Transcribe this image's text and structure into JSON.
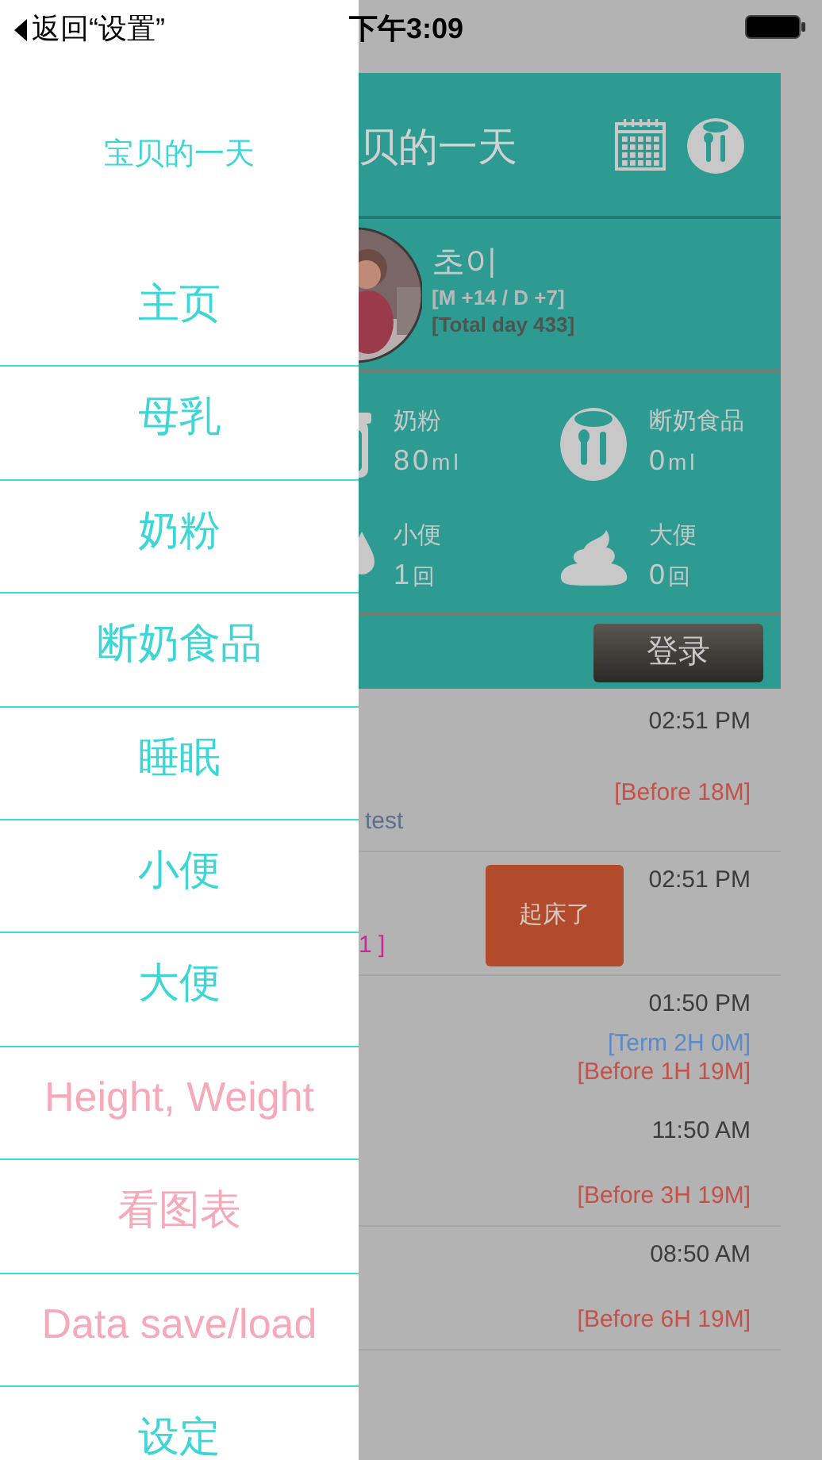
{
  "status_bar": {
    "back_label": "返回“设置”",
    "time": "下午3:09"
  },
  "drawer": {
    "title": "宝贝的一天",
    "items": [
      {
        "label": "主页",
        "color": "#3dd6d6"
      },
      {
        "label": "母乳",
        "color": "#3dd6d6"
      },
      {
        "label": "奶粉",
        "color": "#3dd6d6"
      },
      {
        "label": "断奶食品",
        "color": "#3dd6d6"
      },
      {
        "label": "睡眠",
        "color": "#3dd6d6"
      },
      {
        "label": "小便",
        "color": "#3dd6d6"
      },
      {
        "label": "大便",
        "color": "#3dd6d6"
      },
      {
        "label": "Height, Weight",
        "color": "#f6a9b8"
      },
      {
        "label": "看图表",
        "color": "#f6a9b8"
      },
      {
        "label": "Data save/load",
        "color": "#f6a9b8"
      },
      {
        "label": "设定",
        "color": "#3dd6d6"
      }
    ]
  },
  "header": {
    "title": "贝的一天"
  },
  "profile": {
    "name": "초이",
    "age": "[M +14 / D +7]",
    "total": "[Total day 433]"
  },
  "stats": [
    {
      "kind": "bottle",
      "label": "奶粉",
      "value": "80",
      "unit": "ml"
    },
    {
      "kind": "bib",
      "label": "断奶食品",
      "value": "0",
      "unit": "ml"
    },
    {
      "kind": "drop",
      "label": "小便",
      "value": "1",
      "unit": "回"
    },
    {
      "kind": "poop",
      "label": "大便",
      "value": "0",
      "unit": "回"
    }
  ],
  "login_button": "登录",
  "log": [
    {
      "time": "02:51 PM",
      "tags": [
        {
          "kind": "before",
          "text": "[Before 18M]"
        },
        {
          "kind": "note",
          "text": "test"
        }
      ],
      "divider": true
    },
    {
      "time": "02:51 PM",
      "action": "起床了",
      "tags": [
        {
          "kind": "memo",
          "text": "1 ]"
        }
      ],
      "divider": true
    },
    {
      "time": "01:50 PM",
      "tags": [
        {
          "kind": "term",
          "text": "[Term 2H 0M]"
        },
        {
          "kind": "before",
          "text": "[Before 1H 19M]"
        }
      ],
      "divider": false
    },
    {
      "time": "11:50 AM",
      "tags": [
        {
          "kind": "before",
          "text": "[Before 3H 19M]"
        }
      ],
      "divider": true
    },
    {
      "time": "08:50 AM",
      "tags": [
        {
          "kind": "before",
          "text": "[Before 6H 19M]"
        }
      ],
      "divider": true
    }
  ]
}
